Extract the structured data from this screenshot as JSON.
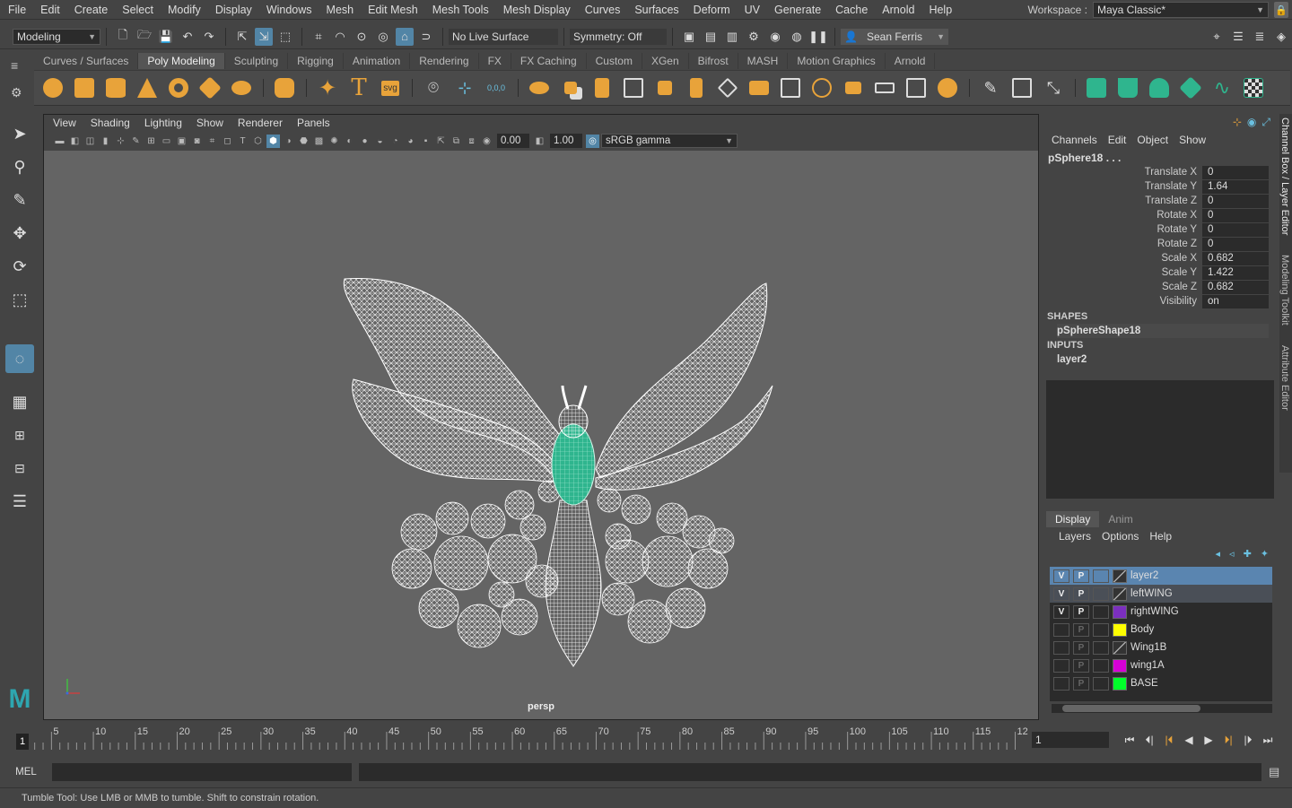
{
  "menubar": {
    "items": [
      "File",
      "Edit",
      "Create",
      "Select",
      "Modify",
      "Display",
      "Windows",
      "Mesh",
      "Edit Mesh",
      "Mesh Tools",
      "Mesh Display",
      "Curves",
      "Surfaces",
      "Deform",
      "UV",
      "Generate",
      "Cache",
      "Arnold",
      "Help"
    ],
    "workspace_label": "Workspace :",
    "workspace_value": "Maya Classic*"
  },
  "statusline": {
    "mode": "Modeling",
    "live_surface": "No Live Surface",
    "symmetry": "Symmetry: Off",
    "user": "Sean Ferris"
  },
  "shelf": {
    "tabs": [
      "Curves / Surfaces",
      "Poly Modeling",
      "Sculpting",
      "Rigging",
      "Animation",
      "Rendering",
      "FX",
      "FX Caching",
      "Custom",
      "XGen",
      "Bifrost",
      "MASH",
      "Motion Graphics",
      "Arnold"
    ],
    "active_tab": "Poly Modeling",
    "text_tool_glyph": "T",
    "svg_tool_label": "svg",
    "coords_glyph": "0,0,0"
  },
  "viewport": {
    "panel_menu": [
      "View",
      "Shading",
      "Lighting",
      "Show",
      "Renderer",
      "Panels"
    ],
    "exposure": "0.00",
    "gamma": "1.00",
    "color_space": "sRGB gamma",
    "camera": "persp"
  },
  "channelbox": {
    "menu": [
      "Channels",
      "Edit",
      "Object",
      "Show"
    ],
    "object_name": "pSphere18 . . .",
    "attributes": [
      {
        "label": "Translate X",
        "value": "0"
      },
      {
        "label": "Translate Y",
        "value": "1.64"
      },
      {
        "label": "Translate Z",
        "value": "0"
      },
      {
        "label": "Rotate X",
        "value": "0"
      },
      {
        "label": "Rotate Y",
        "value": "0"
      },
      {
        "label": "Rotate Z",
        "value": "0"
      },
      {
        "label": "Scale X",
        "value": "0.682"
      },
      {
        "label": "Scale Y",
        "value": "1.422"
      },
      {
        "label": "Scale Z",
        "value": "0.682"
      },
      {
        "label": "Visibility",
        "value": "on"
      }
    ],
    "shapes_header": "SHAPES",
    "shape_name": "pSphereShape18",
    "inputs_header": "INPUTS",
    "input_name": "layer2"
  },
  "layer_editor": {
    "tabs": [
      "Display",
      "Anim"
    ],
    "active_tab": "Display",
    "menu": [
      "Layers",
      "Options",
      "Help"
    ],
    "layers": [
      {
        "v": "V",
        "p": "P",
        "name": "layer2",
        "color": "none",
        "state": "sel"
      },
      {
        "v": "V",
        "p": "P",
        "name": "leftWING",
        "color": "none",
        "state": "sel2"
      },
      {
        "v": "V",
        "p": "P",
        "name": "rightWING",
        "color": "#7b2fbf",
        "state": ""
      },
      {
        "v": "",
        "p": "P",
        "name": "Body",
        "color": "#ffff00",
        "state": ""
      },
      {
        "v": "",
        "p": "P",
        "name": "Wing1B",
        "color": "none",
        "state": ""
      },
      {
        "v": "",
        "p": "P",
        "name": "wing1A",
        "color": "#d600d6",
        "state": ""
      },
      {
        "v": "",
        "p": "P",
        "name": "BASE",
        "color": "#00ff2a",
        "state": ""
      }
    ]
  },
  "side_tabs": [
    "Channel Box / Layer Editor",
    "Modeling Toolkit",
    "Attribute Editor"
  ],
  "timeslider": {
    "ticks": [
      "5",
      "10",
      "15",
      "20",
      "25",
      "30",
      "35",
      "40",
      "45",
      "50",
      "55",
      "60",
      "65",
      "70",
      "75",
      "80",
      "85",
      "90",
      "95",
      "100",
      "105",
      "110",
      "115",
      "12"
    ],
    "current_frame": "1",
    "frame_field": "1"
  },
  "command_line": {
    "label": "MEL"
  },
  "help_line": "Tumble Tool: Use LMB or MMB to tumble. Shift to constrain rotation.",
  "colors": {
    "accent": "#5285a6",
    "shelf_orange": "#e8a33a",
    "selection_green": "#2fb58e",
    "viewport_bg": "#646464"
  }
}
